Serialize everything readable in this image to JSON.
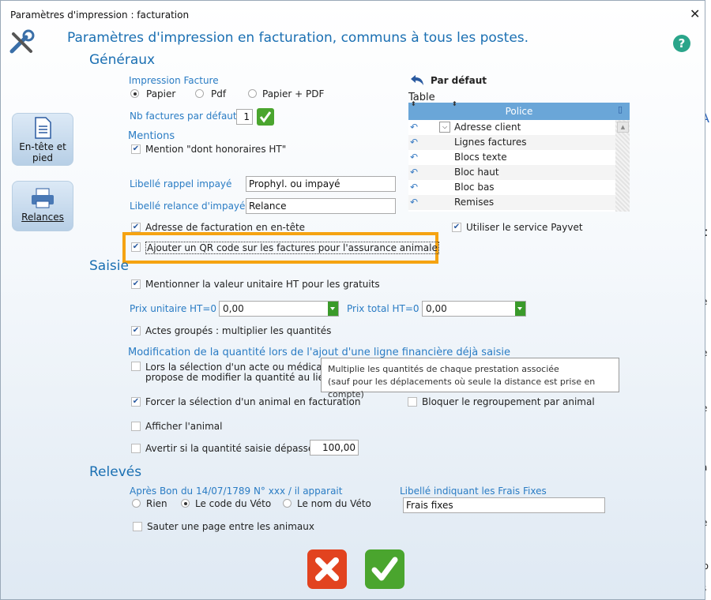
{
  "window": {
    "title": "Paramètres  d'impression : facturation",
    "close_glyph": "✕"
  },
  "heading": "Paramètres d'impression en facturation, communs à tous les  postes.",
  "sidebar": {
    "entete_label": "En-tête et pied",
    "relances_label": "Relances"
  },
  "generaux": {
    "title": "Généraux",
    "impression_label": "Impression Facture",
    "radio_papier": "Papier",
    "radio_pdf": "Pdf",
    "radio_papier_pdf": "Papier + PDF",
    "nb_factures_label": "Nb factures par défaut",
    "nb_factures_value": "1",
    "mentions_label": "Mentions",
    "mention_honoraires": "Mention \"dont honoraires HT\"",
    "libelle_rappel_label": "Libellé rappel impayé",
    "libelle_rappel_value": "Prophyl. ou impayé",
    "libelle_relance_label": "Libellé relance d'impayé",
    "libelle_relance_value": "Relance",
    "adresse_entete": "Adresse de facturation en en-tête",
    "qr_code": "Ajouter un QR code sur les factures pour l'assurance animale",
    "payvet": "Utiliser le service Payvet"
  },
  "table": {
    "par_defaut": "Par défaut",
    "table_label": "Table",
    "col_police": "Police",
    "rows": [
      "Adresse client",
      "Lignes factures",
      "Blocs texte",
      "Bloc haut",
      "Bloc bas",
      "Remises"
    ]
  },
  "saisie": {
    "title": "Saisie",
    "valeur_unitaire": "Mentionner la valeur unitaire HT pour les gratuits",
    "prix_unitaire_label": "Prix unitaire HT=0",
    "prix_unitaire_value": "0,00",
    "prix_total_label": "Prix total HT=0",
    "prix_total_value": "0,00",
    "actes_groupes": "Actes groupés : multiplier les quantités",
    "modif_quantite_label": "Modification de la quantité lors de l'ajout d'une ligne financière déjà saisie",
    "lors_selection_line1": "Lors la sélection d'un acte ou médicam",
    "lors_selection_line2": "propose de modifier la quantité au lieu",
    "forcer_animal": "Forcer la sélection d'un animal en facturation",
    "bloquer_regroupement": "Bloquer le regroupement par animal",
    "afficher_animal": "Afficher l'animal",
    "avertir_quantite": "Avertir si la quantité saisie dépasse",
    "avertir_value": "100,00"
  },
  "tooltip": {
    "line1": "Multiplie les quantités de chaque prestation associée",
    "line2": "(sauf pour les déplacements où seule la distance est prise en compte)"
  },
  "releves": {
    "title": "Relevés",
    "apres_bon_label": "Après Bon du 14/07/1789 N° xxx /  il apparait",
    "radio_rien": "Rien",
    "radio_code_veto": "Le code du Véto",
    "radio_nom_veto": "Le nom du Véto",
    "frais_fixes_label": "Libellé indiquant les Frais Fixes",
    "frais_fixes_value": "Frais fixes",
    "sauter_page": "Sauter une page entre les animaux"
  },
  "background_glyphs": [
    "A",
    "t",
    "e",
    "e",
    "e",
    "a",
    "e",
    "ro",
    "s"
  ],
  "colors": {
    "accent": "#1a6fb2",
    "highlight": "#f5a312",
    "ok_green": "#4aa52e",
    "cancel_red": "#e2431f"
  }
}
